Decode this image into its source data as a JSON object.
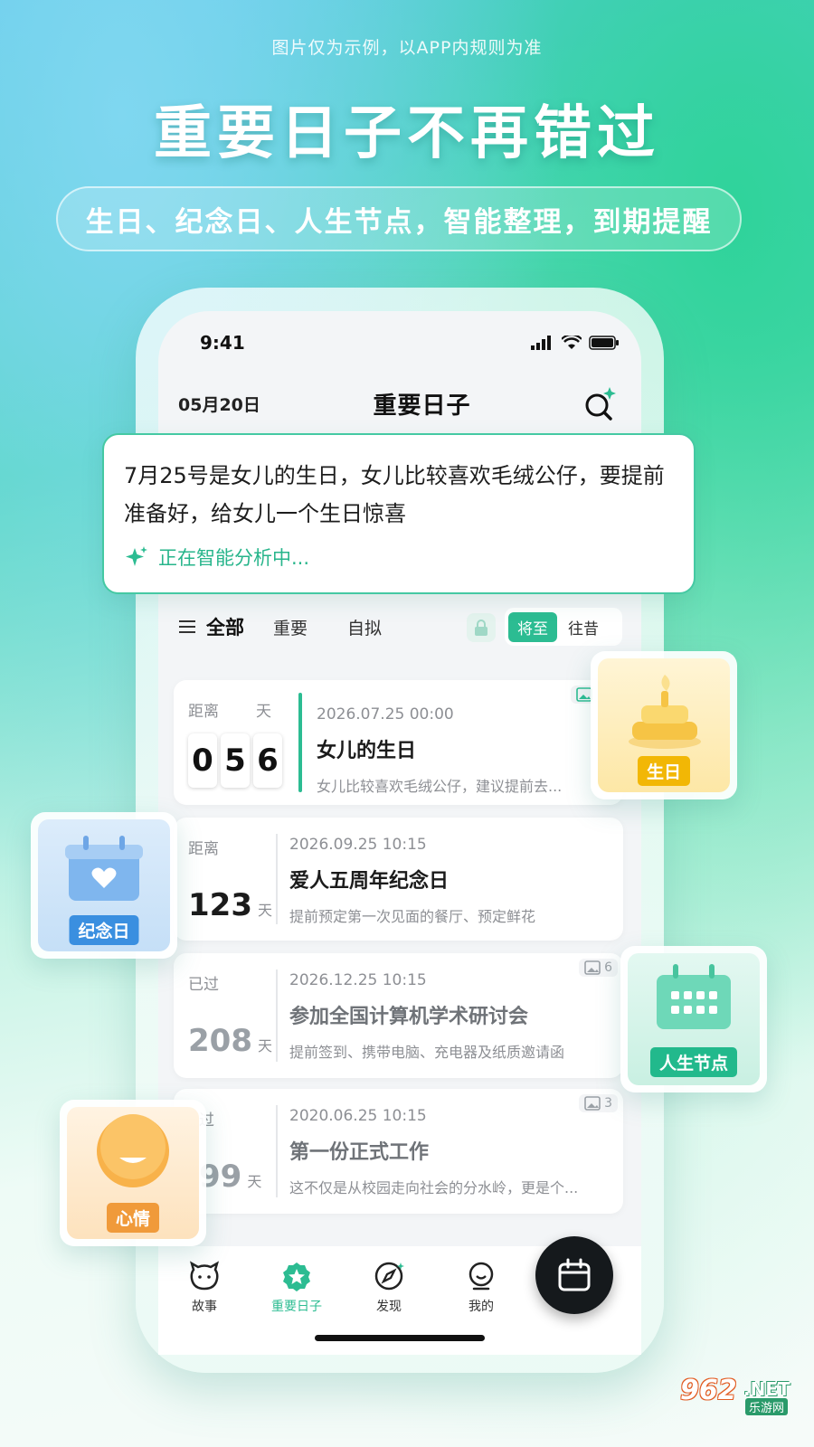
{
  "promo": {
    "disclaimer": "图片仅为示例，以APP内规则为准",
    "headline": "重要日子不再错过",
    "subline": "生日、纪念日、人生节点，智能整理，到期提醒"
  },
  "status_bar": {
    "time": "9:41"
  },
  "header": {
    "date": "05月20日",
    "title": "重要日子"
  },
  "note": {
    "text": "7月25号是女儿的生日，女儿比较喜欢毛绒公仔，要提前准备好，给女儿一个生日惊喜",
    "status": "正在智能分析中..."
  },
  "filters": {
    "tabs": [
      "全部",
      "重要",
      "自拟"
    ],
    "segment": {
      "on": "将至",
      "off": "往昔"
    }
  },
  "cards": [
    {
      "label": "距离",
      "unit": "天",
      "digits": [
        "0",
        "5",
        "6"
      ],
      "date": "2026.07.25 00:00",
      "title": "女儿的生日",
      "desc": "女儿比较喜欢毛绒公仔，建议提前去..."
    },
    {
      "label": "距离",
      "unit": "天",
      "number": "123",
      "date": "2026.09.25 10:15",
      "title": "爱人五周年纪念日",
      "desc": "提前预定第一次见面的餐厅、预定鲜花"
    },
    {
      "label": "已过",
      "unit": "天",
      "number": "208",
      "date": "2026.12.25 10:15",
      "title": "参加全国计算机学术研讨会",
      "desc": "提前签到、携带电脑、充电器及纸质邀请函",
      "image_count": "6"
    },
    {
      "label": "过",
      "unit": "天",
      "number": "99",
      "date": "2020.06.25 10:15",
      "title": "第一份正式工作",
      "desc": "这不仅是从校园走向社会的分水岭，更是个...",
      "image_count": "3"
    }
  ],
  "tiles": {
    "birthday": "生日",
    "anniversary": "纪念日",
    "milestone": "人生节点",
    "mood": "心情"
  },
  "nav": {
    "items": [
      "故事",
      "重要日子",
      "发现",
      "我的"
    ]
  },
  "watermark": {
    "num": "962",
    "net": ".NET",
    "sub": "乐游网"
  },
  "colors": {
    "accent": "#2cbc92",
    "birthday": "#f2b705",
    "anniversary": "#3a8fe0",
    "milestone": "#22b98c",
    "mood": "#f09a3a"
  },
  "icons": [
    "signal-icon",
    "wifi-icon",
    "battery-icon",
    "search-sparkle-icon",
    "sparkle-icon",
    "menu-icon",
    "lock-icon",
    "image-icon",
    "calendar-icon"
  ]
}
